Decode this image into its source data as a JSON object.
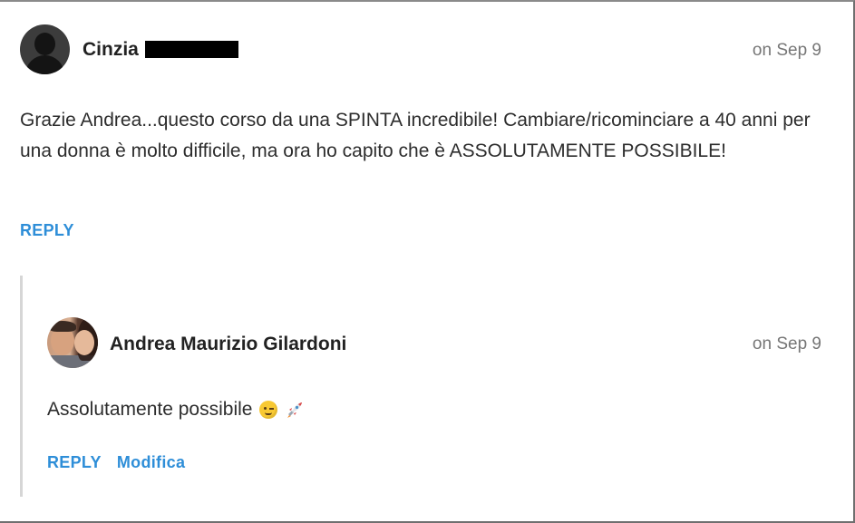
{
  "comment": {
    "author": "Cinzia",
    "date": "on Sep 9",
    "body": "Grazie Andrea...questo corso da una SPINTA incredibile! Cambiare/ricominciare a 40 anni per una donna è molto difficile, ma ora ho capito che è ASSOLUTAMENTE POSSIBILE!",
    "reply_label": "REPLY"
  },
  "reply": {
    "author": "Andrea Maurizio Gilardoni",
    "date": "on Sep 9",
    "body": "Assolutamente possibile",
    "emojis": [
      "winking-face-emoji",
      "rocket-emoji"
    ],
    "reply_label": "REPLY",
    "edit_label": "Modifica"
  },
  "colors": {
    "link": "#2e8ed8",
    "muted": "#767676",
    "thread_line": "#d6d6d6"
  }
}
